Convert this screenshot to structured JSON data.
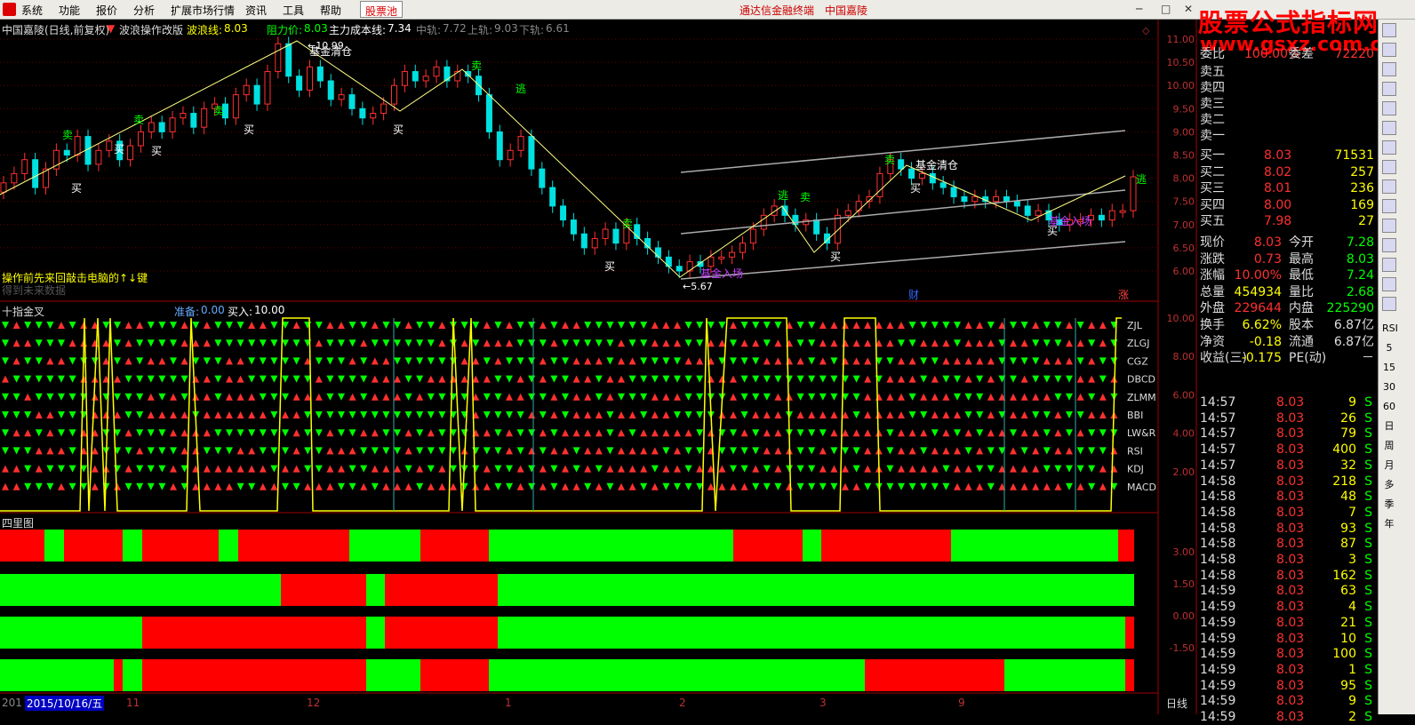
{
  "menu": {
    "items": [
      "系统",
      "功能",
      "报价",
      "分析",
      "扩展市场行情",
      "资讯",
      "工具",
      "帮助"
    ],
    "pool": "股票池",
    "title1": "通达信金融终端",
    "title2": "中国嘉陵"
  },
  "watermark": {
    "cn": "股票公式指标网",
    "url": "www.gsxz.com.cn"
  },
  "main_chart": {
    "stock": "中国嘉陵(日线,前复权)",
    "indicator": "波浪操作改版",
    "wave_label": "波浪线:",
    "wave_value": "8.03",
    "resist_label": "阻力价:",
    "resist_value": "8.03",
    "cost_label": "主力成本线:",
    "cost_value": "7.34",
    "mid_label": "中轨:",
    "mid_value": "7.72",
    "upper_label": "上轨:",
    "upper_value": "9.03",
    "lower_label": "下轨:",
    "lower_value": "6.61",
    "hint": "操作前先来回敲击电脑的↑↓键",
    "hint2": "得到未来数据",
    "price_axis": [
      "11.00",
      "10.50",
      "10.00",
      "9.50",
      "9.00",
      "8.50",
      "8.00",
      "7.50",
      "7.00",
      "6.50",
      "6.00"
    ],
    "hi_label": "10.99",
    "lo_label": "5.67",
    "cai": "财",
    "zhang": "涨",
    "sig_buy": "买",
    "sig_sell": "卖",
    "sig_escape": "逃",
    "sig_clear": "基金清仓",
    "sig_enter": "基金入场"
  },
  "panel2": {
    "title": "十指金叉",
    "ready_label": "准备:",
    "ready_value": "0.00",
    "buy_label": "买入:",
    "buy_value": "10.00",
    "rows": [
      "ZJL",
      "ZLGJ",
      "CGZ",
      "DBCD",
      "ZLMM",
      "BBI",
      "LW&R",
      "RSI",
      "KDJ",
      "MACD"
    ],
    "axis": [
      "10.00",
      "8.00",
      "6.00",
      "4.00",
      "2.00"
    ]
  },
  "panel3": {
    "title": "四里图",
    "axis": [
      "3.00",
      "1.50",
      "0.00",
      "-1.50"
    ]
  },
  "date_axis": {
    "left": "2015/10/16/五",
    "prefix": "201",
    "marks": [
      "11",
      "12",
      "1",
      "2",
      "3",
      "9"
    ],
    "period": "日线"
  },
  "quote": {
    "webi_label": "委比",
    "webi_value": "100.00%",
    "weicha_label": "委差",
    "weicha_value": "72220",
    "sells": [
      "卖五",
      "卖四",
      "卖三",
      "卖二",
      "卖一"
    ],
    "buys": [
      {
        "label": "买一",
        "price": "8.03",
        "vol": "71531"
      },
      {
        "label": "买二",
        "price": "8.02",
        "vol": "257"
      },
      {
        "label": "买三",
        "price": "8.01",
        "vol": "236"
      },
      {
        "label": "买四",
        "price": "8.00",
        "vol": "169"
      },
      {
        "label": "买五",
        "price": "7.98",
        "vol": "27"
      }
    ],
    "stats": [
      {
        "l1": "现价",
        "v1": "8.03",
        "l2": "今开",
        "v2": "7.28"
      },
      {
        "l1": "涨跌",
        "v1": "0.73",
        "l2": "最高",
        "v2": "8.03"
      },
      {
        "l1": "涨幅",
        "v1": "10.00%",
        "l2": "最低",
        "v2": "7.24"
      },
      {
        "l1": "总量",
        "v1": "454934",
        "l2": "量比",
        "v2": "2.68"
      },
      {
        "l1": "外盘",
        "v1": "229644",
        "l2": "内盘",
        "v2": "225290"
      },
      {
        "l1": "换手",
        "v1": "6.62%",
        "l2": "股本",
        "v2": "6.87亿"
      },
      {
        "l1": "净资",
        "v1": "-0.18",
        "l2": "流通",
        "v2": "6.87亿"
      },
      {
        "l1": "收益(三)",
        "v1": "-0.175",
        "l2": "PE(动)",
        "v2": "－"
      }
    ],
    "ticks": [
      {
        "t": "14:57",
        "p": "8.03",
        "v": "9",
        "s": "S"
      },
      {
        "t": "14:57",
        "p": "8.03",
        "v": "26",
        "s": "S"
      },
      {
        "t": "14:57",
        "p": "8.03",
        "v": "79",
        "s": "S"
      },
      {
        "t": "14:57",
        "p": "8.03",
        "v": "400",
        "s": "S"
      },
      {
        "t": "14:57",
        "p": "8.03",
        "v": "32",
        "s": "S"
      },
      {
        "t": "14:58",
        "p": "8.03",
        "v": "218",
        "s": "S"
      },
      {
        "t": "14:58",
        "p": "8.03",
        "v": "48",
        "s": "S"
      },
      {
        "t": "14:58",
        "p": "8.03",
        "v": "7",
        "s": "S"
      },
      {
        "t": "14:58",
        "p": "8.03",
        "v": "93",
        "s": "S"
      },
      {
        "t": "14:58",
        "p": "8.03",
        "v": "87",
        "s": "S"
      },
      {
        "t": "14:58",
        "p": "8.03",
        "v": "3",
        "s": "S"
      },
      {
        "t": "14:58",
        "p": "8.03",
        "v": "162",
        "s": "S"
      },
      {
        "t": "14:59",
        "p": "8.03",
        "v": "63",
        "s": "S"
      },
      {
        "t": "14:59",
        "p": "8.03",
        "v": "4",
        "s": "S"
      },
      {
        "t": "14:59",
        "p": "8.03",
        "v": "21",
        "s": "S"
      },
      {
        "t": "14:59",
        "p": "8.03",
        "v": "10",
        "s": "S"
      },
      {
        "t": "14:59",
        "p": "8.03",
        "v": "100",
        "s": "S"
      },
      {
        "t": "14:59",
        "p": "8.03",
        "v": "1",
        "s": "S"
      },
      {
        "t": "14:59",
        "p": "8.03",
        "v": "95",
        "s": "S"
      },
      {
        "t": "14:59",
        "p": "8.03",
        "v": "9",
        "s": "S"
      },
      {
        "t": "14:59",
        "p": "8.03",
        "v": "2",
        "s": "S"
      }
    ]
  },
  "toolbar": [
    "RSI",
    "5",
    "15",
    "30",
    "60",
    "日",
    "周",
    "月",
    "多",
    "季",
    "年"
  ],
  "colors": {
    "up": "#ff3030",
    "down": "#00e0e0",
    "green": "#00ff00",
    "red": "#ff0000",
    "yellow": "#ffff00",
    "grid": "#600000"
  }
}
